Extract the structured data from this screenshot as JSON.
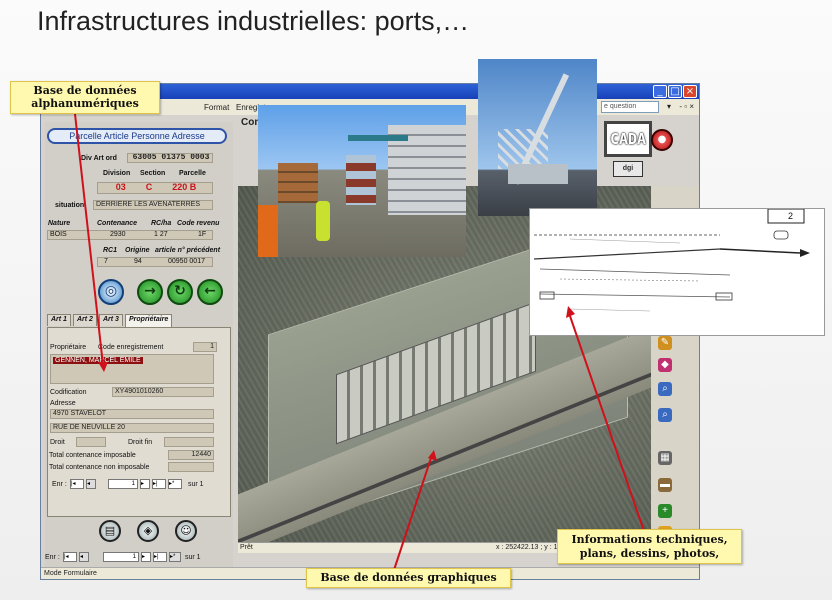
{
  "slide": {
    "title": "Infrastructures industrielles: ports,…"
  },
  "window": {
    "menu": {
      "format": "Format",
      "enregistrement": "Enregist",
      "ask_question": "e question"
    },
    "controls": {
      "min": "_",
      "max": "□",
      "close": "×"
    }
  },
  "form": {
    "nav_tabs": "Parcelle  Article  Personne  Adresse",
    "div_art_ord_label": "Div Art ord",
    "div_art_ord_value": "63005   01375 0003",
    "division_label": "Division",
    "section_label": "Section",
    "parcelle_label": "Parcelle",
    "division_value": "03",
    "section_value": "C",
    "parcelle_value": "220 B",
    "situation_label": "situation",
    "situation_value": "DERRIERE LES AVENATERRES",
    "nature_label": "Nature",
    "contenance_label": "Contenance",
    "rc_ha_label": "RC/ha",
    "code_revenu_label": "Code revenu",
    "nature_value": "BOIS",
    "contenance_value": "2930",
    "rc_ha_value": "1   27",
    "code_revenu_value": "1F",
    "rc1_label": "RC1",
    "origine_label": "Origine",
    "article_prec_label": "article n° précédent",
    "rc1_value": "7",
    "origine_value": "94",
    "article_prec_value": "00950  0017",
    "tabs": [
      "Art 1",
      "Art 2",
      "Art 3",
      "Propriétaire"
    ],
    "proprietaire_label": "Propriétaire",
    "code_enreg_label": "Code enregistrement",
    "code_enreg_value": "1",
    "owner_name": "GENNEN, MARCEL EMILE",
    "codification_label": "Codification",
    "codification_value": "XY4901010260",
    "adresse_label": "Adresse",
    "adresse_line1": "4970 STAVELOT",
    "adresse_line2": "RUE DE NEUVILLE 20",
    "droit_label": "Droit",
    "droit_fin_label": "Droit fin",
    "total_imposable_label": "Total contenance imposable",
    "total_imposable_value": "12440",
    "total_non_imposable_label": "Total contenance non imposable",
    "enr_label": "Enr :",
    "enr_value": "1",
    "sur_label": "sur 1",
    "enr_bottom_label": "Enr :",
    "enr_bottom_value": "1",
    "sur_bottom_label": "sur 1"
  },
  "status": {
    "mode": "Mode Formulaire",
    "pret": "Prêt",
    "coords": "x : 252422.13 ; y : 1"
  },
  "map": {
    "com_label": "Com"
  },
  "logo": {
    "text": "CADA STR",
    "sub": "dgi"
  },
  "callouts": {
    "alpha": "Base de données alphanumériques",
    "tech_line1": "Informations techniques,",
    "tech_line2": "plans, dessins, photos,",
    "graph": "Base de données graphiques"
  },
  "plan": {
    "sheet_number": "2"
  },
  "colors": {
    "accent_red": "#d0101a",
    "callout_bg": "#fff9b0",
    "titlebar": "#2e62d6"
  }
}
